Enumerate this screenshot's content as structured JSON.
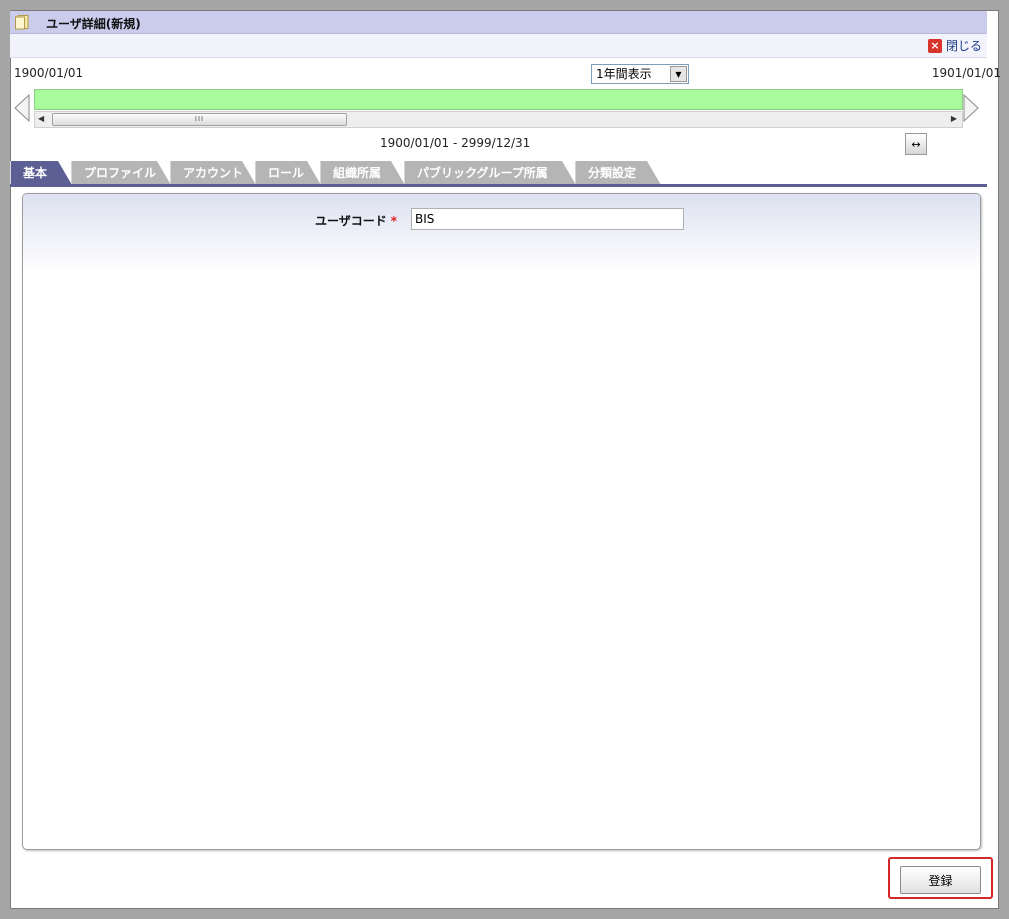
{
  "header": {
    "title": "ユーザ詳細(新規)",
    "close_label": "閉じる"
  },
  "timeline": {
    "start_date": "1900/01/01",
    "end_date": "1901/01/01",
    "range_select_value": "1年間表示",
    "period": "1900/01/01 - 2999/12/31",
    "bar_color": "#a7fb9d"
  },
  "tabs": [
    {
      "label": "基本",
      "active": true
    },
    {
      "label": "プロファイル",
      "active": false
    },
    {
      "label": "アカウント",
      "active": false
    },
    {
      "label": "ロール",
      "active": false
    },
    {
      "label": "組織所属",
      "active": false
    },
    {
      "label": "パブリックグループ所属",
      "active": false
    },
    {
      "label": "分類設定",
      "active": false
    }
  ],
  "form": {
    "usercode_label": "ユーザコード",
    "required_mark": "*",
    "usercode_value": "BIS"
  },
  "actions": {
    "register_label": "登録"
  },
  "icons": {
    "title": "document-icon",
    "close": "close-icon",
    "expand": "expand-width-icon"
  },
  "colors": {
    "accent": "#5c5f94",
    "titlebar": "#cbcbec",
    "highlight": "#d22828"
  }
}
